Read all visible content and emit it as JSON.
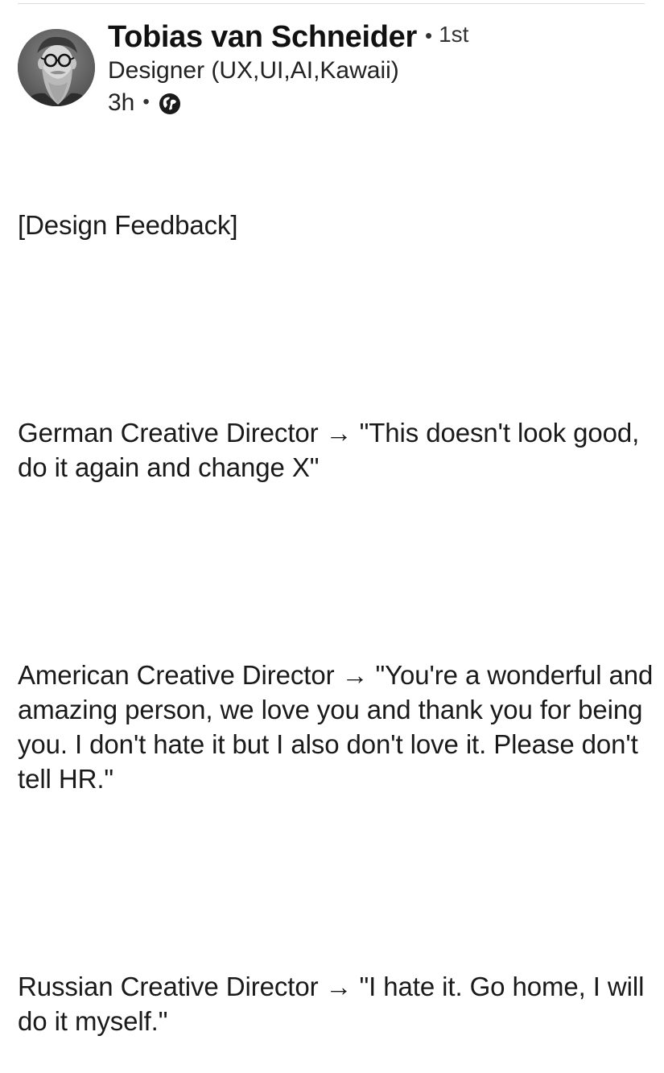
{
  "post": {
    "author": {
      "name": "Tobias van Schneider",
      "connection_degree": "1st",
      "headline": "Designer (UX,UI,AI,Kawaii)"
    },
    "posted_ago": "3h",
    "separator": "•",
    "visibility_icon": "globe-icon",
    "body": {
      "title": "[Design Feedback]",
      "german": "German Creative Director → \"This doesn't look good, do it again and change X\"",
      "american": "American Creative Director → \"You're a wonderful and amazing person, we love you and thank you for being you. I don't hate it but I also don't love it. Please don't tell HR.\"",
      "russian": "Russian Creative Director → \"I hate it. Go home, I will do it myself.\""
    }
  }
}
